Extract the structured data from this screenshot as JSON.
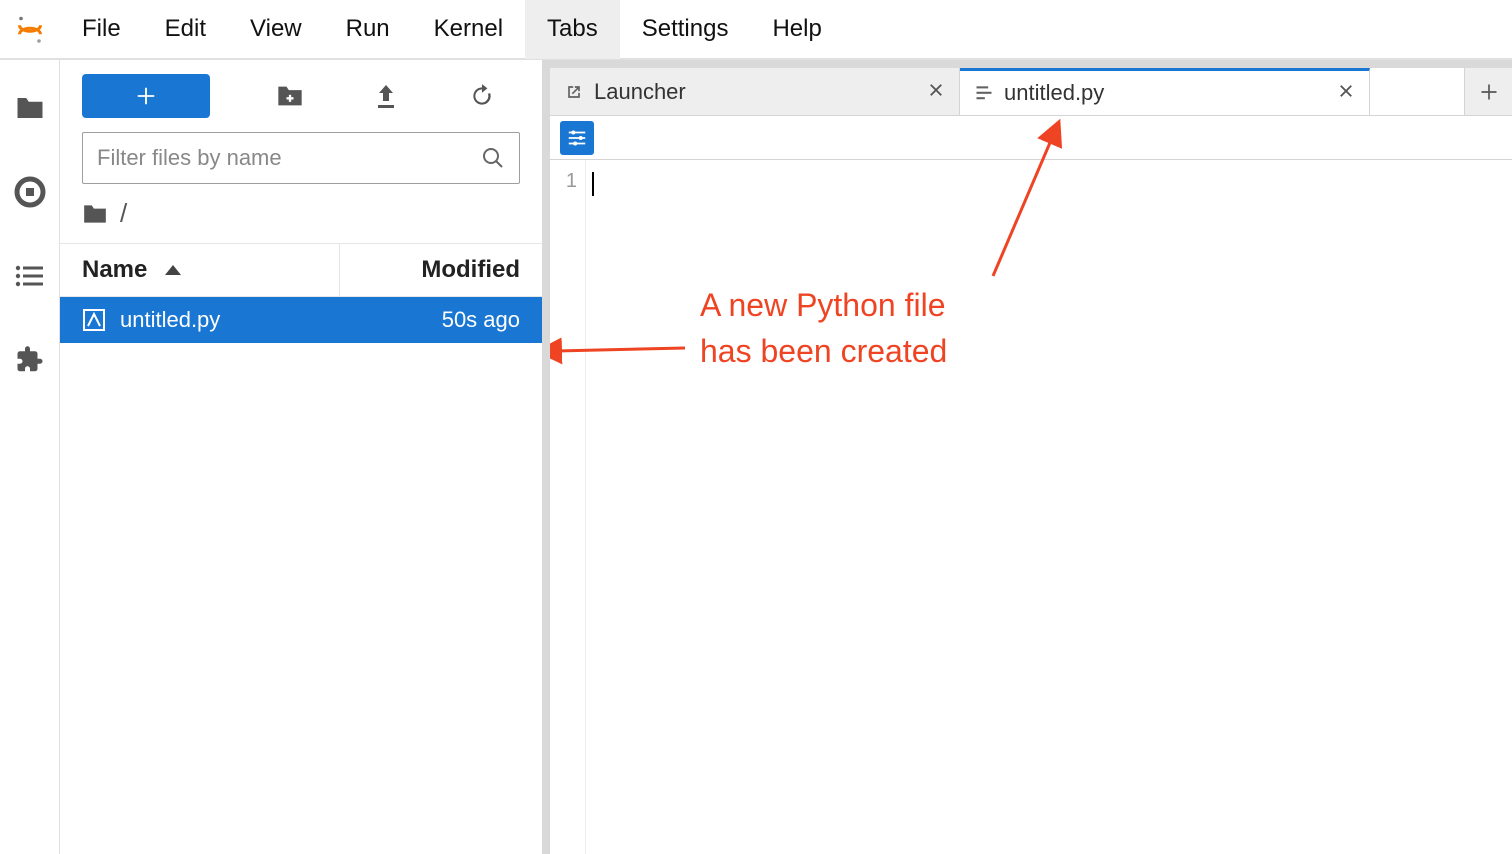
{
  "menu": {
    "items": [
      "File",
      "Edit",
      "View",
      "Run",
      "Kernel",
      "Tabs",
      "Settings",
      "Help"
    ],
    "active_index": 5
  },
  "rail": {
    "items": [
      "folder-icon",
      "stop-icon",
      "list-icon",
      "puzzle-icon"
    ]
  },
  "filebrowser": {
    "filter_placeholder": "Filter files by name",
    "breadcrumb_root": "/",
    "columns": {
      "name": "Name",
      "modified": "Modified"
    },
    "files": [
      {
        "name": "untitled.py",
        "modified": "50s ago",
        "selected": true
      }
    ]
  },
  "tabs": {
    "items": [
      {
        "label": "Launcher",
        "icon": "launch-icon",
        "active": false
      },
      {
        "label": "untitled.py",
        "icon": "lines-icon",
        "active": true
      }
    ]
  },
  "editor": {
    "line_numbers": [
      "1"
    ],
    "content": ""
  },
  "annotation": {
    "text": "A new Python file\nhas been created"
  }
}
